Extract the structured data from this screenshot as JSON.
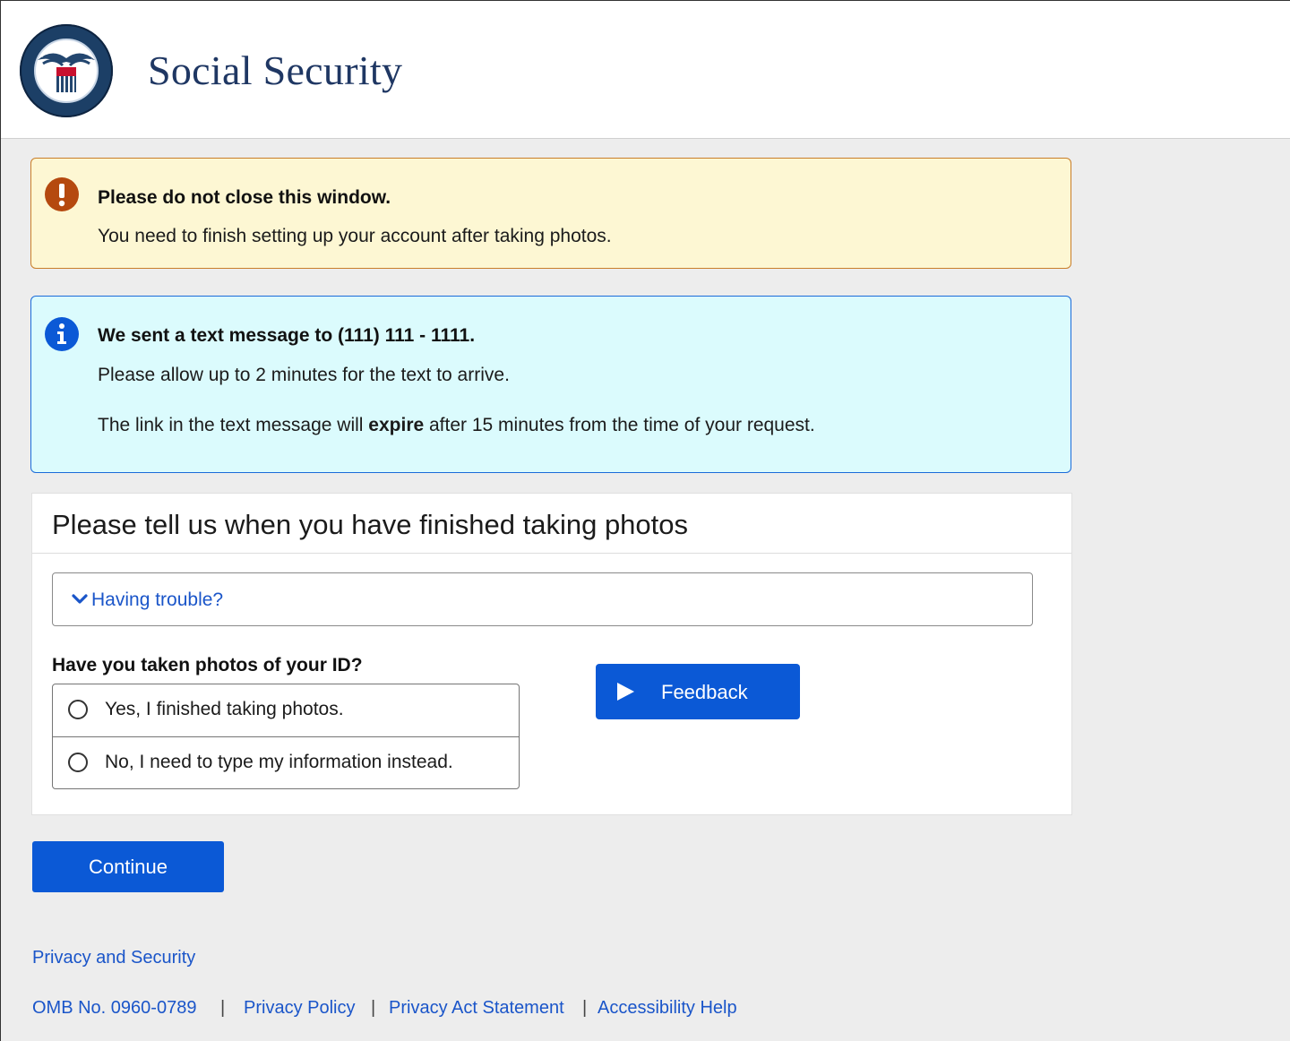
{
  "header": {
    "title": "Social Security",
    "logo": "ssa-seal-logo"
  },
  "warning_alert": {
    "icon": "exclamation-icon",
    "title": "Please do not close this window.",
    "text": "You need to finish setting up your account after taking photos.",
    "color": "#fdf7d3"
  },
  "info_alert": {
    "icon": "info-icon",
    "title": "We sent a text message to (111) 111 - 1111.",
    "line1": "Please allow up to 2 minutes for the text to arrive.",
    "line2_pre": "The link in the text message will ",
    "line2_bold": "expire",
    "line2_post": " after 15 minutes from the time of your request.",
    "color": "#dbfbfd"
  },
  "card": {
    "title": "Please tell us when you have finished taking photos",
    "accordion_label": "Having trouble?",
    "question": "Have you taken photos of your ID?",
    "options": [
      "Yes, I finished taking photos.",
      "No, I need to type my information instead."
    ],
    "feedback_label": "Feedback"
  },
  "continue_label": "Continue",
  "footer": {
    "privacy_security": "Privacy and Security",
    "omb": "OMB No. 0960-0789",
    "privacy_policy": "Privacy Policy",
    "privacy_act": "Privacy Act Statement",
    "accessibility": "Accessibility Help",
    "separator": "|"
  },
  "colors": {
    "primary_button": "#0b59d6",
    "link": "#1a55c9",
    "brand_navy": "#1f3763"
  }
}
